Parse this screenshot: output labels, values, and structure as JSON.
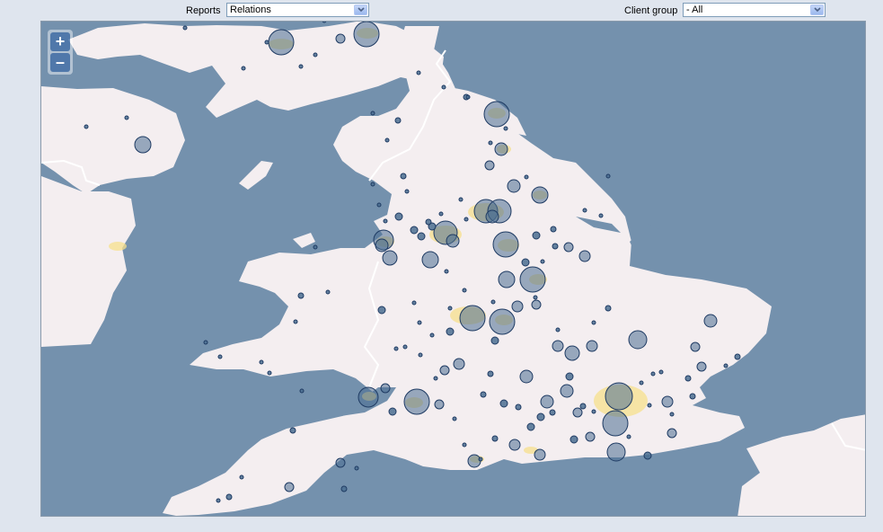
{
  "toolbar": {
    "reports_label": "Reports",
    "reports_value": "Relations",
    "client_group_label": "Client group",
    "client_group_value": "- All"
  },
  "map": {
    "zoom_in_label": "+",
    "zoom_out_label": "–",
    "colors": {
      "sea": "#7491ad",
      "land": "#f4eef0",
      "urban": "#f7e08c",
      "border": "#ffffff",
      "marker_fill": "#4a6d91",
      "marker_stroke": "#1f3b63"
    }
  }
}
